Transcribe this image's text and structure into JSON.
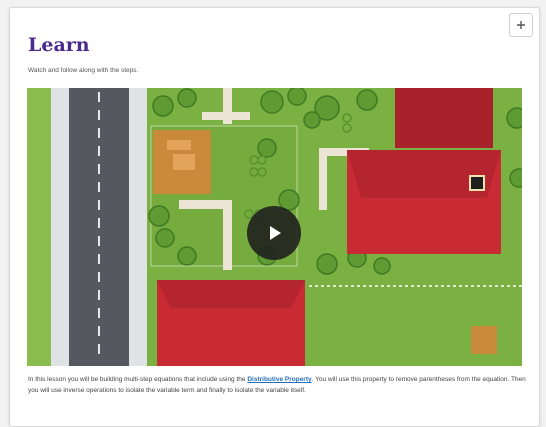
{
  "lesson": {
    "title": "Learn",
    "subtitle": "Watch and follow along with the steps.",
    "body_before_link": "In this lesson you will be building multi-step equations that include using the ",
    "link_text": "Distributive Property",
    "body_after_link": ". You will use this property to remove parentheses from the equation. Then you will use inverse operations to isolate the variable term and finally to isolate the variable itself."
  },
  "icons": {
    "expand": "plus-icon",
    "play": "play-icon"
  },
  "colors": {
    "title": "#4b2a8c",
    "link": "#1f6fb8",
    "grass": "#7bb043",
    "roof": "#c92b35",
    "road": "#55595f"
  }
}
